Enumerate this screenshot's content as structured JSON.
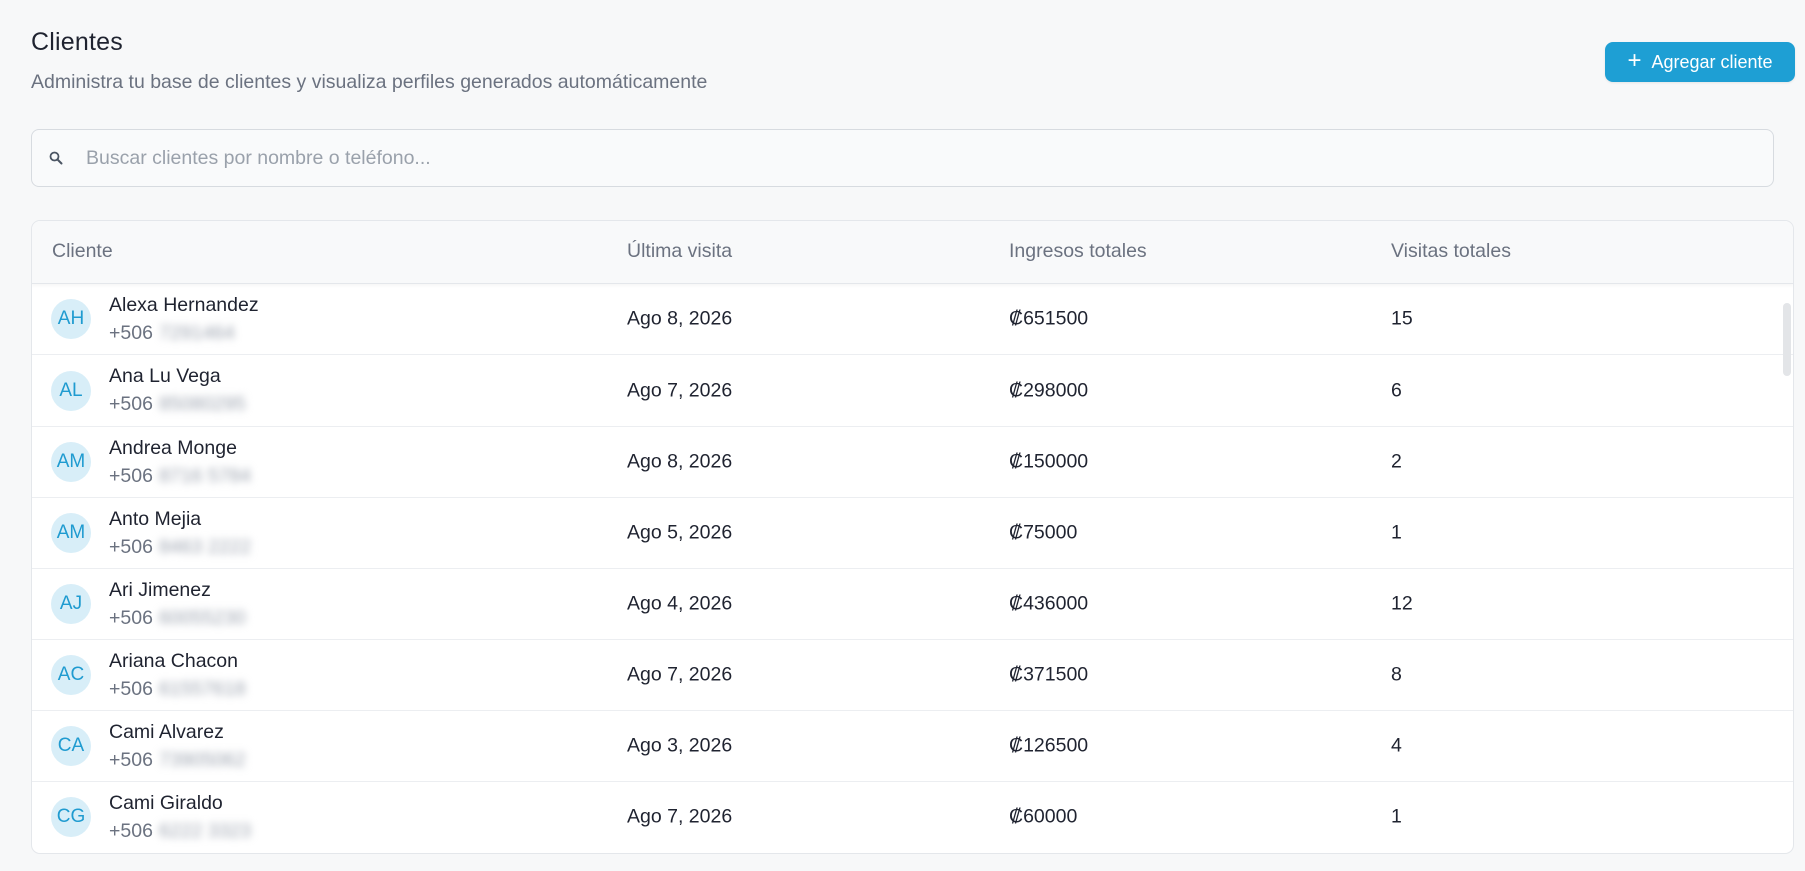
{
  "header": {
    "title": "Clientes",
    "subtitle": "Administra tu base de clientes y visualiza perfiles generados automáticamente",
    "add_button_icon": "plus-icon",
    "add_button_label": "Agregar cliente"
  },
  "search": {
    "icon": "search-icon",
    "placeholder": "Buscar clientes por nombre o teléfono...",
    "value": ""
  },
  "table": {
    "columns": [
      "Cliente",
      "Última visita",
      "Ingresos totales",
      "Visitas totales"
    ],
    "rows": [
      {
        "initials": "AH",
        "name": "Alexa Hernandez",
        "phone_prefix": "+506",
        "phone_hidden": "7291464",
        "last_visit": "Ago 8, 2026",
        "income": "₡651500",
        "visits": "15"
      },
      {
        "initials": "AL",
        "name": "Ana Lu Vega",
        "phone_prefix": "+506",
        "phone_hidden": "85080295",
        "last_visit": "Ago 7, 2026",
        "income": "₡298000",
        "visits": "6"
      },
      {
        "initials": "AM",
        "name": "Andrea Monge",
        "phone_prefix": "+506",
        "phone_hidden": "8716 5784",
        "last_visit": "Ago 8, 2026",
        "income": "₡150000",
        "visits": "2"
      },
      {
        "initials": "AM",
        "name": "Anto Mejia",
        "phone_prefix": "+506",
        "phone_hidden": "8463 2222",
        "last_visit": "Ago 5, 2026",
        "income": "₡75000",
        "visits": "1"
      },
      {
        "initials": "AJ",
        "name": "Ari Jimenez",
        "phone_prefix": "+506",
        "phone_hidden": "60055230",
        "last_visit": "Ago 4, 2026",
        "income": "₡436000",
        "visits": "12"
      },
      {
        "initials": "AC",
        "name": "Ariana Chacon",
        "phone_prefix": "+506",
        "phone_hidden": "61557618",
        "last_visit": "Ago 7, 2026",
        "income": "₡371500",
        "visits": "8"
      },
      {
        "initials": "CA",
        "name": "Cami Alvarez",
        "phone_prefix": "+506",
        "phone_hidden": "73905062",
        "last_visit": "Ago 3, 2026",
        "income": "₡126500",
        "visits": "4"
      },
      {
        "initials": "CG",
        "name": "Cami Giraldo",
        "phone_prefix": "+506",
        "phone_hidden": "6222 3323",
        "last_visit": "Ago 7, 2026",
        "income": "₡60000",
        "visits": "1"
      }
    ]
  },
  "colors": {
    "accent": "#1e9fd4",
    "avatar_bg": "#d8eef8",
    "avatar_text": "#1f9bd0",
    "background": "#f7f8f9"
  }
}
